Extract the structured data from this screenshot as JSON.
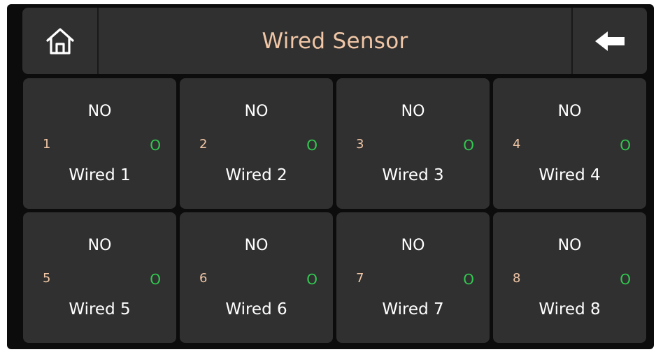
{
  "header": {
    "title": "Wired Sensor",
    "home_icon": "home-icon",
    "back_icon": "arrow-left-icon"
  },
  "colors": {
    "background": "#0c0c0c",
    "panel": "#303030",
    "accent": "#f0c6a6",
    "status_ok": "#32c850",
    "text": "#ffffff"
  },
  "sensors": [
    {
      "state": "NO",
      "number": "1",
      "indicator": "O",
      "name": "Wired 1"
    },
    {
      "state": "NO",
      "number": "2",
      "indicator": "O",
      "name": "Wired 2"
    },
    {
      "state": "NO",
      "number": "3",
      "indicator": "O",
      "name": "Wired 3"
    },
    {
      "state": "NO",
      "number": "4",
      "indicator": "O",
      "name": "Wired 4"
    },
    {
      "state": "NO",
      "number": "5",
      "indicator": "O",
      "name": "Wired 5"
    },
    {
      "state": "NO",
      "number": "6",
      "indicator": "O",
      "name": "Wired 6"
    },
    {
      "state": "NO",
      "number": "7",
      "indicator": "O",
      "name": "Wired 7"
    },
    {
      "state": "NO",
      "number": "8",
      "indicator": "O",
      "name": "Wired 8"
    }
  ]
}
